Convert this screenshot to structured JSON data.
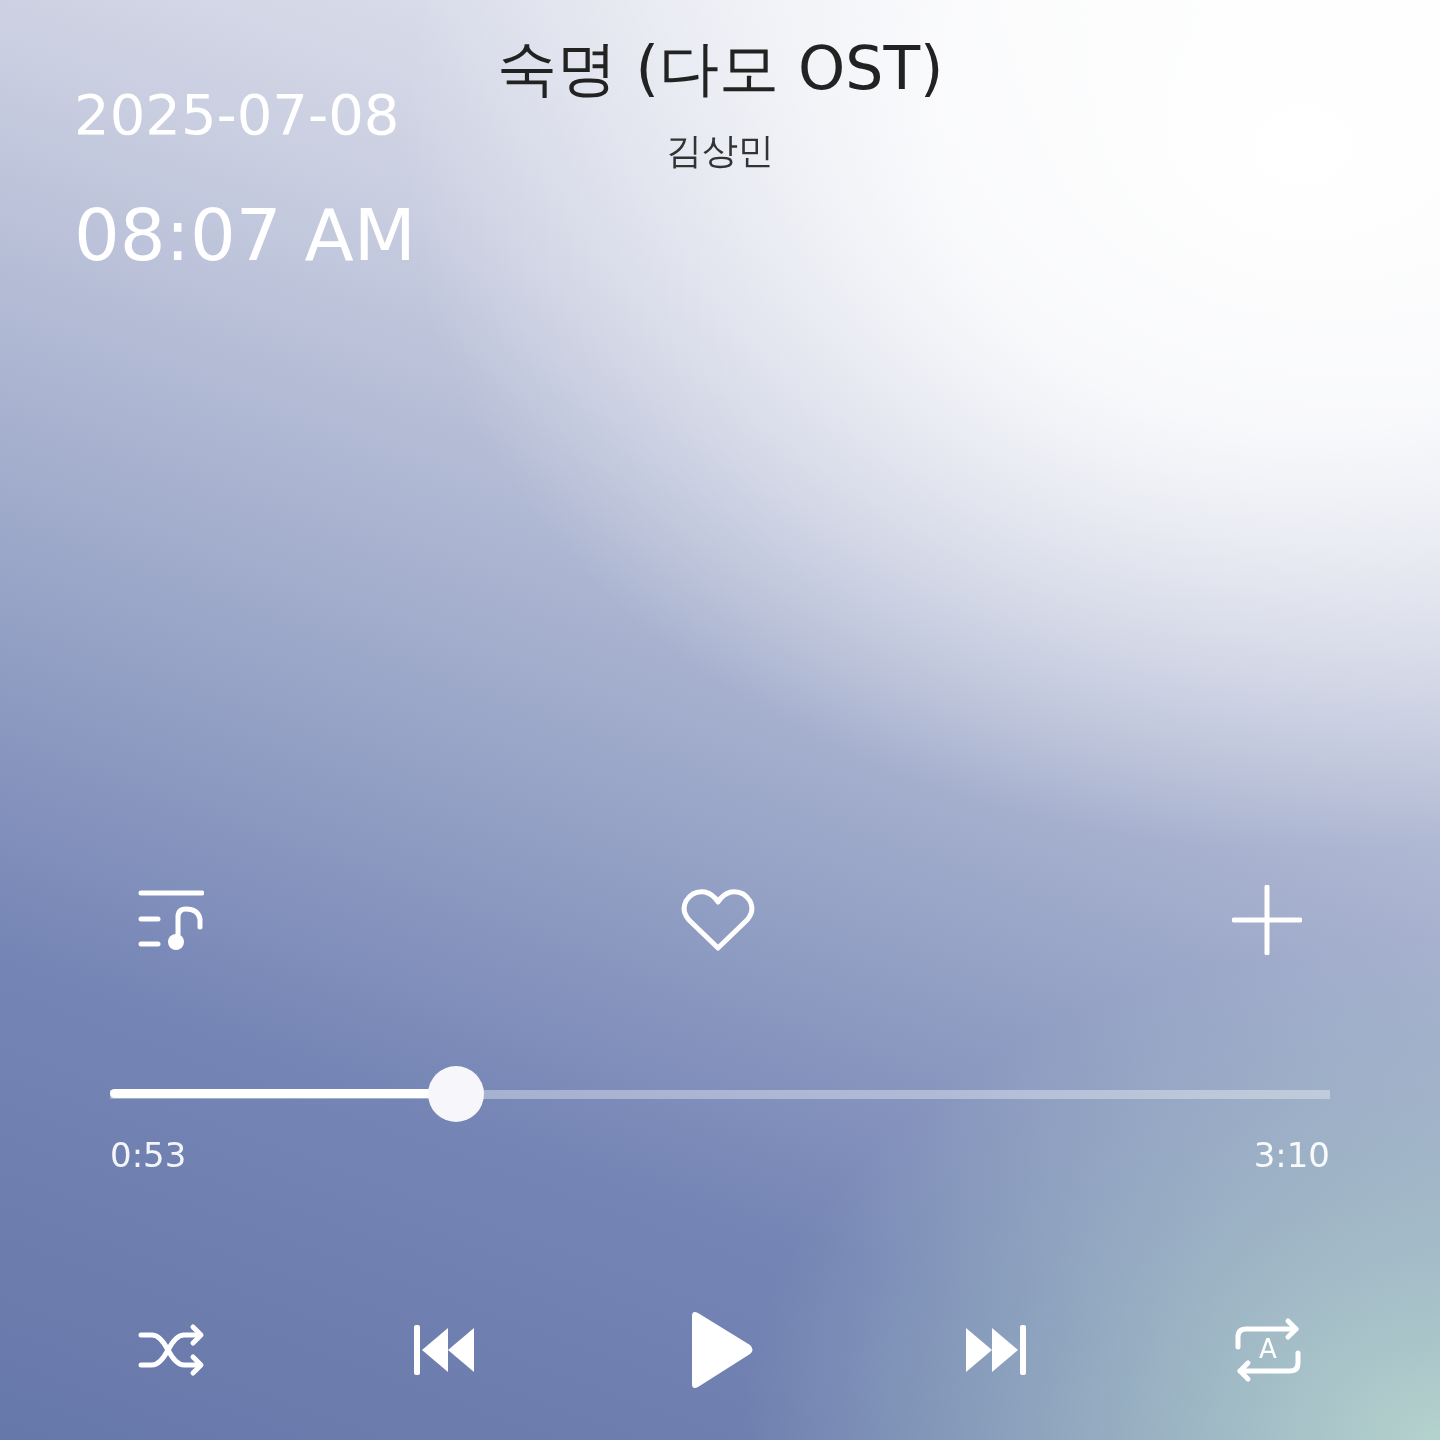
{
  "clock": {
    "date": "2025-07-08",
    "time": "08:07 AM"
  },
  "track": {
    "title": "숙명 (다모 OST)",
    "artist": "김상민",
    "liked": false
  },
  "progress": {
    "level": 0.284,
    "elapsed": "0:53",
    "duration": "3:10"
  },
  "playback": {
    "playing": false,
    "shuffle": false,
    "repeat_label": "A"
  }
}
